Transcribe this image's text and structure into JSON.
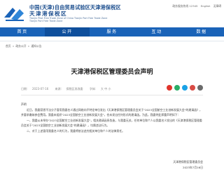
{
  "header": {
    "title_cn": "中国(天津)自由贸易试验区天津港保税区",
    "title_sub": "天津港保税区",
    "title_en_1": "Tianjin Pilot Free Trade Zone of China Tianjin Port Free Trade Zone",
    "title_en_2": "Tianjin Port Free Trade Zone",
    "top_links": [
      "政务服务热线 12345",
      "English",
      "无障碍"
    ]
  },
  "nav": {
    "items": [
      "首页",
      "公开",
      "服务",
      "互动",
      "数据"
    ]
  },
  "breadcrumb": [
    "首页",
    "»",
    "政务公开",
    "»",
    "通知公告"
  ],
  "article": {
    "title": "天津港保税区管理委员会声明",
    "meta_date_label": "日期：",
    "meta_date": "2023-07-16",
    "meta_source_label": "来源：",
    "meta_source": "保税区发改委",
    "font_size_label": "字体：",
    "font_sizes": "大 中 小",
    "salute": "声明",
    "paragraphs": [
      "近日，我委获悉不法分子冒用我委名义通过网络向不特定单位发出《天津港保税区管理委员会关于\"2023全国航空工业创新发展大会\"的邀请函》，并要求缴纳参会费用。我委未组织\"2023全国航空工业创新发展大会\"，也未发出任何形式的邀请函。为此，我委特此郑重声明如下：",
      "一、我委从未举办\"2023全国航空工业创新发展大会\"，相关邀请函系伪造，与我委无关，任何单位和个人以我委名义发出的《天津港保税区管理委员会关于\"2023全国航空工业创新发展大会\"的邀请函》，均属违法行为。",
      "二、对于上述冒用我委名义的行为，我委将依法追究相关单位和个人的法律责任。"
    ],
    "sign_org": "天津港保税区管理委员会",
    "sign_date": "2023年7月16日"
  },
  "colors": {
    "brand": "#1a63b8",
    "brand_dark": "#0f4f9c",
    "share": [
      "#e0342b",
      "#2aae67",
      "#1aa2e6",
      "#d94b45",
      "#6b6b6b"
    ]
  },
  "share_icons": [
    "weibo-icon",
    "wechat-icon",
    "qq-icon",
    "qzone-icon",
    "print-icon"
  ]
}
